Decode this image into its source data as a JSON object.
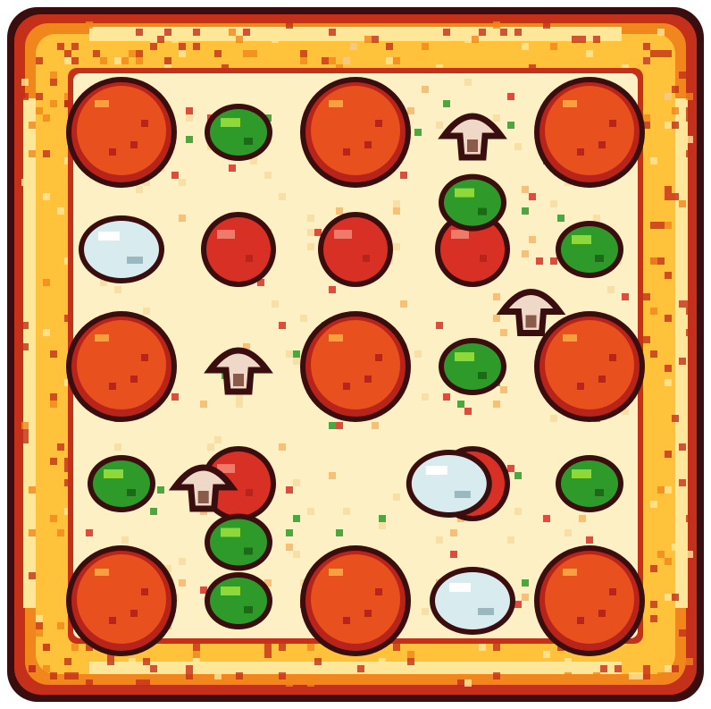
{
  "game": {
    "type": "pixel-art pizza tile",
    "palette": {
      "crust_dark": "#c4301a",
      "crust_mid": "#f0861c",
      "crust_light": "#ffc23a",
      "crust_highlight": "#ffe79a",
      "cheese": "#fdf0c4",
      "cheese_shade": "#f6dca0",
      "pepperoni": "#e8501e",
      "pepperoni_dark": "#b8241a",
      "tomato": "#d83024",
      "tomato_highlight": "#f07a6a",
      "pepper_green": "#2e9a2a",
      "pepper_light": "#8fd83a",
      "mushroom": "#f0d8c8",
      "mushroom_dark": "#8a5a4a",
      "onion": "#d8ecf0",
      "outline": "#3a0e0e"
    },
    "toppings": {
      "pepperoni": [
        {
          "col": 0,
          "row": 0
        },
        {
          "col": 2,
          "row": 0
        },
        {
          "col": 4,
          "row": 0
        },
        {
          "col": 0,
          "row": 2
        },
        {
          "col": 2,
          "row": 2
        },
        {
          "col": 4,
          "row": 2
        },
        {
          "col": 0,
          "row": 4
        },
        {
          "col": 2,
          "row": 4
        },
        {
          "col": 4,
          "row": 4
        }
      ],
      "tomato": [
        {
          "col": 1,
          "row": 1
        },
        {
          "col": 2,
          "row": 1
        },
        {
          "col": 3,
          "row": 1
        },
        {
          "col": 1,
          "row": 3
        },
        {
          "col": 3,
          "row": 3
        }
      ],
      "green_pepper": [
        {
          "col": 1,
          "row": 0
        },
        {
          "col": 3,
          "row": 0.6
        },
        {
          "col": 4,
          "row": 1
        },
        {
          "col": 3,
          "row": 2
        },
        {
          "col": 0,
          "row": 3
        },
        {
          "col": 1,
          "row": 3.5
        },
        {
          "col": 4,
          "row": 3
        },
        {
          "col": 1,
          "row": 4
        }
      ],
      "mushroom": [
        {
          "col": 3,
          "row": 0
        },
        {
          "col": 1,
          "row": 2
        },
        {
          "col": 3.5,
          "row": 1.5
        },
        {
          "col": 0.7,
          "row": 3
        }
      ],
      "onion": [
        {
          "col": 0,
          "row": 1
        },
        {
          "col": 2.8,
          "row": 3
        },
        {
          "col": 3,
          "row": 4
        }
      ]
    }
  }
}
